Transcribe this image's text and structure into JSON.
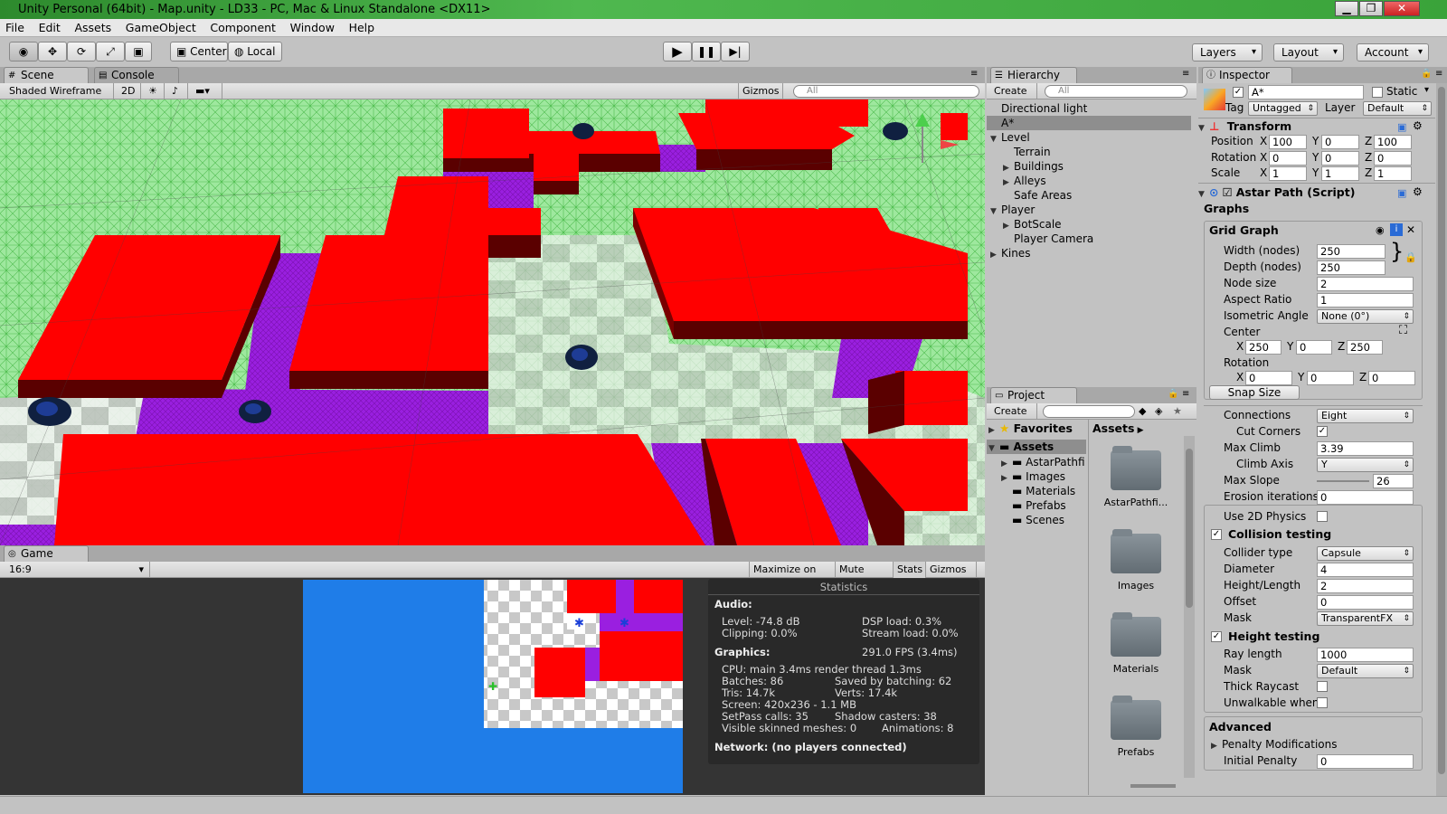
{
  "window": {
    "title": "Unity Personal (64bit) - Map.unity - LD33 - PC, Mac & Linux Standalone <DX11>"
  },
  "menu": [
    "File",
    "Edit",
    "Assets",
    "GameObject",
    "Component",
    "Window",
    "Help"
  ],
  "toolbar": {
    "pivot_label": "Center",
    "space_label": "Local",
    "layers_label": "Layers",
    "layout_label": "Layout",
    "account_label": "Account"
  },
  "scene": {
    "tab_scene": "Scene",
    "tab_console": "Console",
    "shading": "Shaded Wireframe",
    "mode_2d": "2D",
    "gizmos": "Gizmos",
    "search_placeholder": "All"
  },
  "game": {
    "tab": "Game",
    "aspect": "16:9",
    "maximize_label": "Maximize on Play",
    "mute_label": "Mute audio",
    "stats_label": "Stats",
    "gizmos_label": "Gizmos",
    "stats": {
      "title": "Statistics",
      "audio_header": "Audio:",
      "level": "Level: -74.8 dB",
      "clipping": "Clipping: 0.0%",
      "dsp": "DSP load: 0.3%",
      "stream": "Stream load: 0.0%",
      "graphics_header": "Graphics:",
      "fps": "291.0 FPS (3.4ms)",
      "cpu": "CPU: main 3.4ms  render thread 1.3ms",
      "batches": "Batches: 86",
      "saved": "Saved by batching: 62",
      "tris": "Tris: 14.7k",
      "verts": "Verts: 17.4k",
      "screen": "Screen: 420x236 - 1.1 MB",
      "setpass": "SetPass calls: 35",
      "shadow": "Shadow casters: 38",
      "skinned": "Visible skinned meshes: 0",
      "animations": "Animations: 8",
      "network": "Network: (no players connected)"
    }
  },
  "hierarchy": {
    "tab": "Hierarchy",
    "create": "Create",
    "search_placeholder": "All",
    "items": [
      {
        "label": "Directional light"
      },
      {
        "label": "A*"
      },
      {
        "label": "Level"
      },
      {
        "label": "Terrain"
      },
      {
        "label": "Buildings"
      },
      {
        "label": "Alleys"
      },
      {
        "label": "Safe Areas"
      },
      {
        "label": "Player"
      },
      {
        "label": "BotScale"
      },
      {
        "label": "Player Camera"
      },
      {
        "label": "Kines"
      }
    ]
  },
  "project": {
    "tab": "Project",
    "create": "Create",
    "favorites": "Favorites",
    "assets_crumb": "Assets",
    "tree": [
      "Assets",
      "AstarPathfi",
      "Images",
      "Materials",
      "Prefabs",
      "Scenes"
    ],
    "grid": [
      "AstarPathfi...",
      "Images",
      "Materials",
      "Prefabs"
    ]
  },
  "inspector": {
    "tab": "Inspector",
    "object_name": "A*",
    "static_label": "Static",
    "tag_label": "Tag",
    "tag_value": "Untagged",
    "layer_label": "Layer",
    "layer_value": "Default",
    "transform": {
      "title": "Transform",
      "position_label": "Position",
      "rotation_label": "Rotation",
      "scale_label": "Scale",
      "position": [
        "100",
        "0",
        "100"
      ],
      "rotation": [
        "0",
        "0",
        "0"
      ],
      "scale": [
        "1",
        "1",
        "1"
      ]
    },
    "astar": {
      "title": "Astar Path (Script)",
      "graphs": "Graphs",
      "grid_graph": "Grid Graph",
      "width_label": "Width (nodes)",
      "width": "250",
      "depth_label": "Depth (nodes)",
      "depth": "250",
      "node_size_label": "Node size",
      "node_size": "2",
      "aspect_label": "Aspect Ratio",
      "aspect": "1",
      "iso_label": "Isometric Angle",
      "iso": "None (0°)",
      "center_label": "Center",
      "center": [
        "250",
        "0",
        "250"
      ],
      "rotation_label": "Rotation",
      "rotation": [
        "0",
        "0",
        "0"
      ],
      "snap_label": "Snap Size",
      "connections_label": "Connections",
      "connections": "Eight",
      "cut_corners_label": "Cut Corners",
      "max_climb_label": "Max Climb",
      "max_climb": "3.39",
      "climb_axis_label": "Climb Axis",
      "climb_axis": "Y",
      "max_slope_label": "Max Slope",
      "max_slope": "26",
      "erosion_label": "Erosion iterations",
      "erosion": "0",
      "use2d_label": "Use 2D Physics",
      "collision_label": "Collision testing",
      "collider_type_label": "Collider type",
      "collider_type": "Capsule",
      "diameter_label": "Diameter",
      "diameter": "4",
      "height_length_label": "Height/Length",
      "height_length": "2",
      "offset_label": "Offset",
      "offset": "0",
      "mask_label": "Mask",
      "mask": "TransparentFX",
      "height_testing_label": "Height testing",
      "ray_length_label": "Ray length",
      "ray_length": "1000",
      "mask2_label": "Mask",
      "mask2": "Default",
      "thick_raycast_label": "Thick Raycast",
      "unwalkable_label": "Unwalkable when",
      "advanced": "Advanced",
      "penalty_mods": "Penalty Modifications",
      "initial_penalty_label": "Initial Penalty",
      "initial_penalty": "0"
    }
  },
  "axes": {
    "x": "X",
    "y": "Y",
    "z": "Z"
  },
  "colors": {
    "building_red": "#ff0000",
    "alley_purple": "#9a1fe0",
    "navmesh_green": "#8fe58f",
    "sky_blue": "#1f7de8"
  }
}
